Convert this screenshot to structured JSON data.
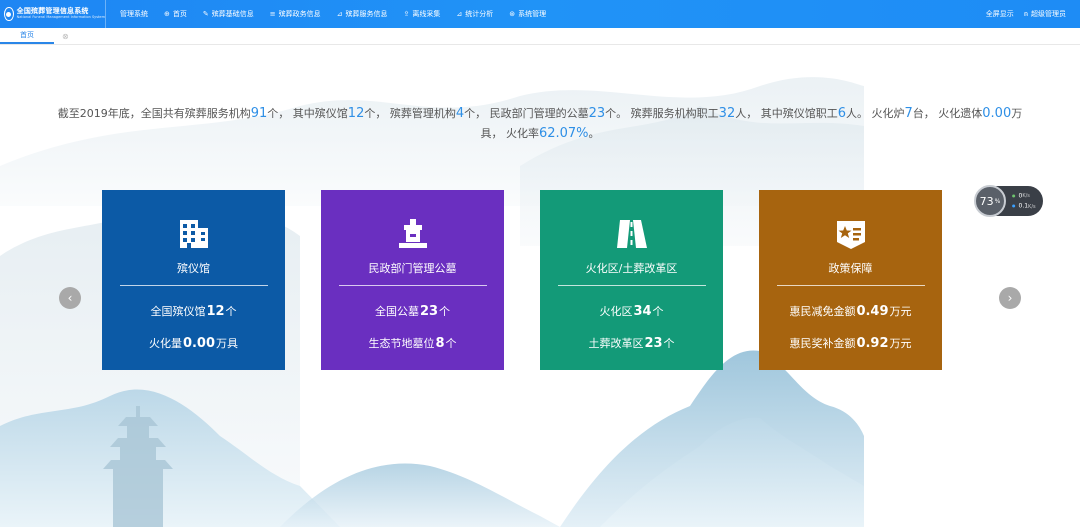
{
  "header": {
    "brand_title": "全国殡葬管理信息系统",
    "brand_subtitle": "National Funeral Management Information System",
    "nav": [
      {
        "label": "管理系统",
        "icon": ""
      },
      {
        "label": "首页",
        "icon": "globe-icon"
      },
      {
        "label": "殡葬基础信息",
        "icon": "edit-icon"
      },
      {
        "label": "殡葬政务信息",
        "icon": "list-icon"
      },
      {
        "label": "殡葬服务信息",
        "icon": "chart-icon"
      },
      {
        "label": "离线采集",
        "icon": "upload-icon"
      },
      {
        "label": "统计分析",
        "icon": "bar-chart-icon"
      },
      {
        "label": "系统管理",
        "icon": "settings-icon"
      }
    ],
    "fullscreen_label": "全屏显示",
    "user_label": "超级管理员"
  },
  "tabs": {
    "home_label": "首页",
    "close_symbol": "⊗"
  },
  "summary": {
    "p1": "截至2019年底，全国共有殡葬服务机构",
    "n1": "91",
    "p2": "个， 其中殡仪馆",
    "n2": "12",
    "p3": "个， 殡葬管理机构",
    "n3": "4",
    "p4": "个， 民政部门管理的公墓",
    "n4": "23",
    "p5": "个。 殡葬服务机构职工",
    "n5": "32",
    "p6": "人， 其中殡仪馆职工",
    "n6": "6",
    "p7": "人。 火化炉",
    "n7": "7",
    "p8": "台， 火化遗体",
    "n8": "0.00",
    "p9": "万具， 火化率",
    "n9": "62.07%",
    "p10": "。"
  },
  "cards": [
    {
      "title": "殡仪馆",
      "color": "#0c5aa6",
      "icon": "building-icon",
      "line1_pre": "全国殡仪馆",
      "line1_val": "12",
      "line1_post": "个",
      "line2_pre": "火化量",
      "line2_val": "0.00",
      "line2_post": "万具"
    },
    {
      "title": "民政部门管理公墓",
      "color": "#6a2fc0",
      "icon": "tomb-icon",
      "line1_pre": "全国公墓",
      "line1_val": "23",
      "line1_post": "个",
      "line2_pre": "生态节地墓位",
      "line2_val": "8",
      "line2_post": "个"
    },
    {
      "title": "火化区/土葬改革区",
      "color": "#139a78",
      "icon": "road-icon",
      "line1_pre": "火化区",
      "line1_val": "34",
      "line1_post": "个",
      "line2_pre": "土葬改革区",
      "line2_val": "23",
      "line2_post": "个"
    },
    {
      "title": "政策保障",
      "color": "#a7640f",
      "icon": "policy-icon",
      "line1_pre": "惠民减免金额",
      "line1_val": "0.49",
      "line1_post": "万元",
      "line2_pre": "惠民奖补金额",
      "line2_val": "0.92",
      "line2_post": "万元"
    }
  ],
  "perf": {
    "percent": "73",
    "percent_unit": "%",
    "up": "0",
    "up_unit": "K/s",
    "down": "0.1",
    "down_unit": "K/s"
  },
  "carousel": {
    "prev_symbol": "‹",
    "next_symbol": "›"
  }
}
